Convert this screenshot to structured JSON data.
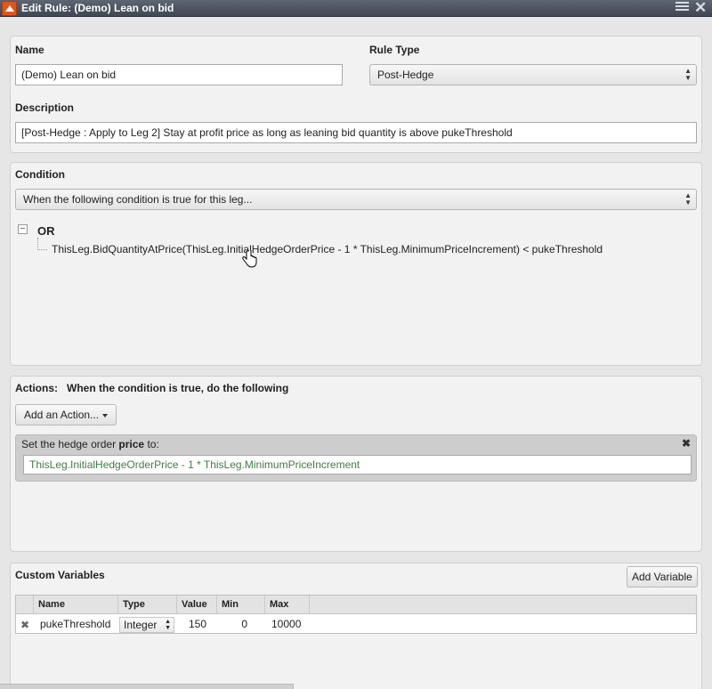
{
  "window": {
    "title": "Edit Rule: (Demo) Lean on bid",
    "icons": [
      "app-icon",
      "list-icon",
      "close-icon"
    ]
  },
  "general": {
    "name_label": "Name",
    "name_value": "(Demo) Lean on bid",
    "rule_type_label": "Rule Type",
    "rule_type_value": "Post-Hedge",
    "description_label": "Description",
    "description_value": "[Post-Hedge : Apply to Leg 2] Stay at profit price as long as leaning bid quantity is above pukeThreshold"
  },
  "condition": {
    "label": "Condition",
    "mode_value": "When the following condition is true for this leg...",
    "tree": {
      "toggle": "−",
      "operator": "OR",
      "expression": "ThisLeg.BidQuantityAtPrice(ThisLeg.InitialHedgeOrderPrice - 1 * ThisLeg.MinimumPriceIncrement) < pukeThreshold"
    }
  },
  "actions": {
    "label": "Actions:",
    "subtitle": "When the condition is true, do the following",
    "add_button": "Add an Action...",
    "items": [
      {
        "title_prefix": "Set the hedge order ",
        "title_bold": "price",
        "title_suffix": " to:",
        "remove": "✖",
        "value": "ThisLeg.InitialHedgeOrderPrice - 1 * ThisLeg.MinimumPriceIncrement"
      }
    ]
  },
  "custom_variables": {
    "label": "Custom Variables",
    "add_button": "Add Variable",
    "columns": [
      "Name",
      "Type",
      "Value",
      "Min",
      "Max"
    ],
    "rows": [
      {
        "remove": "✖",
        "name": "pukeThreshold",
        "type": "Integer",
        "value": "150",
        "min": "0",
        "max": "10000"
      }
    ]
  }
}
